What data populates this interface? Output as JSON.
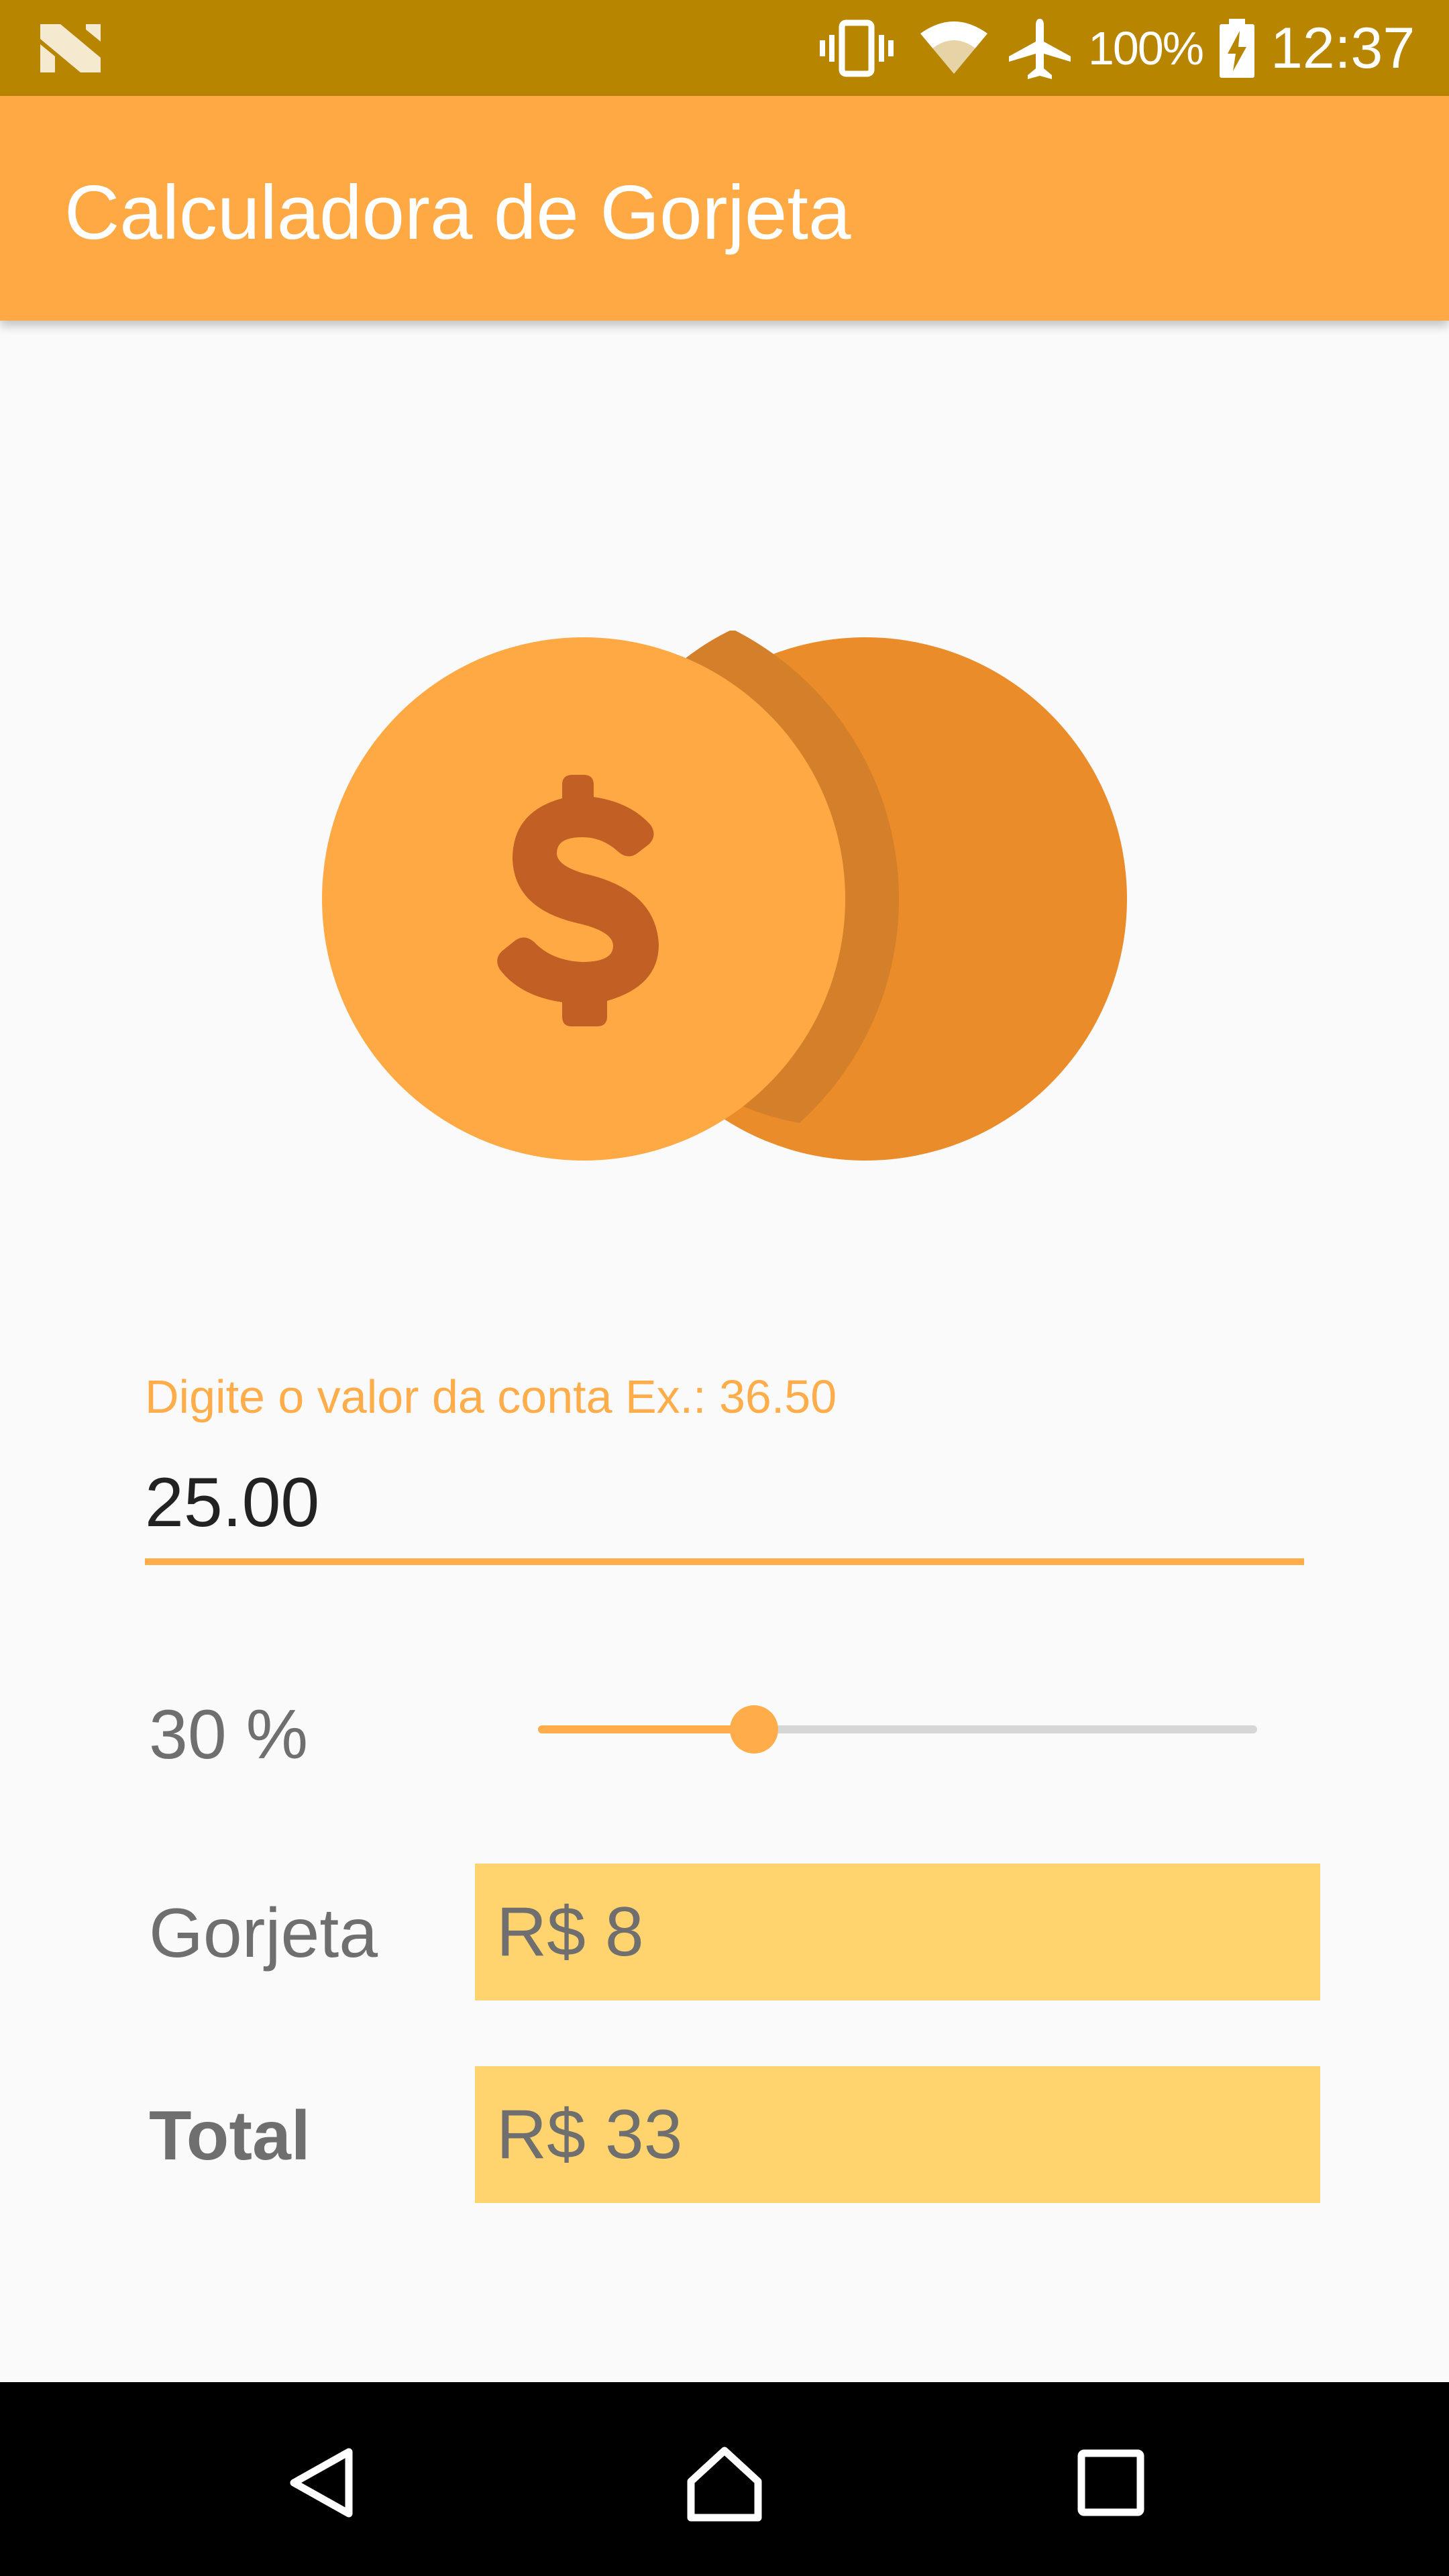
{
  "status_bar": {
    "notification_icon": "android-n-icon",
    "icons": [
      "vibrate-icon",
      "wifi-icon",
      "airplane-mode-icon",
      "battery-charging-icon"
    ],
    "battery_percent": "100%",
    "time": "12:37"
  },
  "app_bar": {
    "title": "Calculadora de Gorjeta"
  },
  "hero": {
    "icon": "coins-dollar-icon"
  },
  "bill_input": {
    "label": "Digite o valor da conta Ex.: 36.50",
    "value": "25.00"
  },
  "tip_percent": {
    "label": "30 %",
    "slider_level": 0.3
  },
  "results": {
    "tip_label": "Gorjeta",
    "tip_value": "R$ 8",
    "total_label": "Total",
    "total_value": "R$ 33"
  },
  "nav_bar": {
    "icons": [
      "back-icon",
      "home-icon",
      "recents-icon"
    ]
  },
  "colors": {
    "status_bar": "#b88500",
    "app_bar": "#ffa944",
    "accent": "#ffad4a",
    "result_box": "#ffd46f",
    "coin_front": "#ffa944",
    "coin_back": "#eb8c2a",
    "dollar_sign": "#c15f24"
  }
}
